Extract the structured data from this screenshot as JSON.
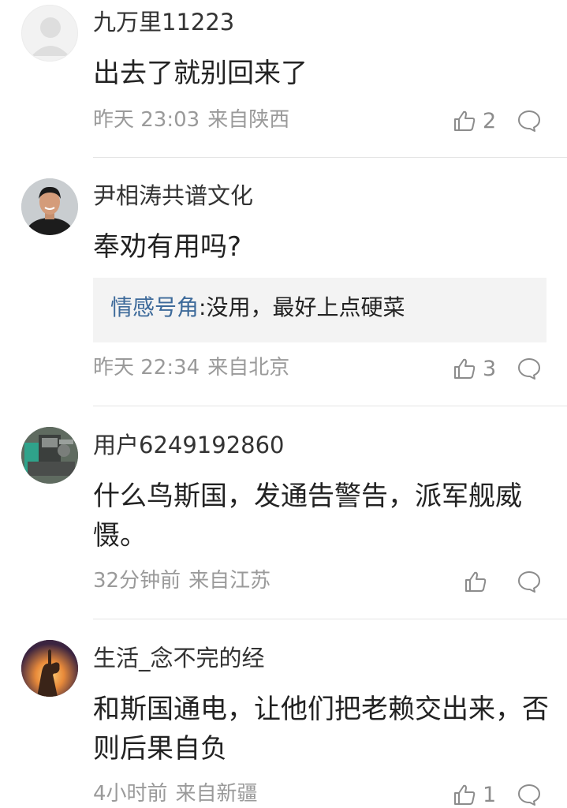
{
  "comments": [
    {
      "username": "九万里11223",
      "content": "出去了就别回来了",
      "time": "昨天 23:03",
      "location": "来自陕西",
      "likes": "2",
      "avatar": "default-avatar"
    },
    {
      "username": "尹相涛共谱文化",
      "content": "奉劝有用吗?",
      "reply": {
        "author": "情感号角",
        "text": ":没用，最好上点硬菜"
      },
      "time": "昨天 22:34",
      "location": "来自北京",
      "likes": "3",
      "avatar": "man-portrait"
    },
    {
      "username": "用户6249192860",
      "content": "什么鸟斯国，发通告警告，派军舰威慑。",
      "time": "32分钟前",
      "location": "来自江苏",
      "likes": "",
      "avatar": "machine-photo"
    },
    {
      "username": "生活_念不完的经",
      "content": "和斯国通电，让他们把老赖交出来，否则后果自负",
      "time": "4小时前",
      "location": "来自新疆",
      "likes": "1",
      "avatar": "hand-sunset"
    }
  ],
  "icons": {
    "like": "thumbs-up-icon",
    "reply": "speech-bubble-icon"
  },
  "colors": {
    "reply_author": "#3d6a9a",
    "meta_text": "#9a9a9a",
    "divider": "#e4e4e4"
  }
}
